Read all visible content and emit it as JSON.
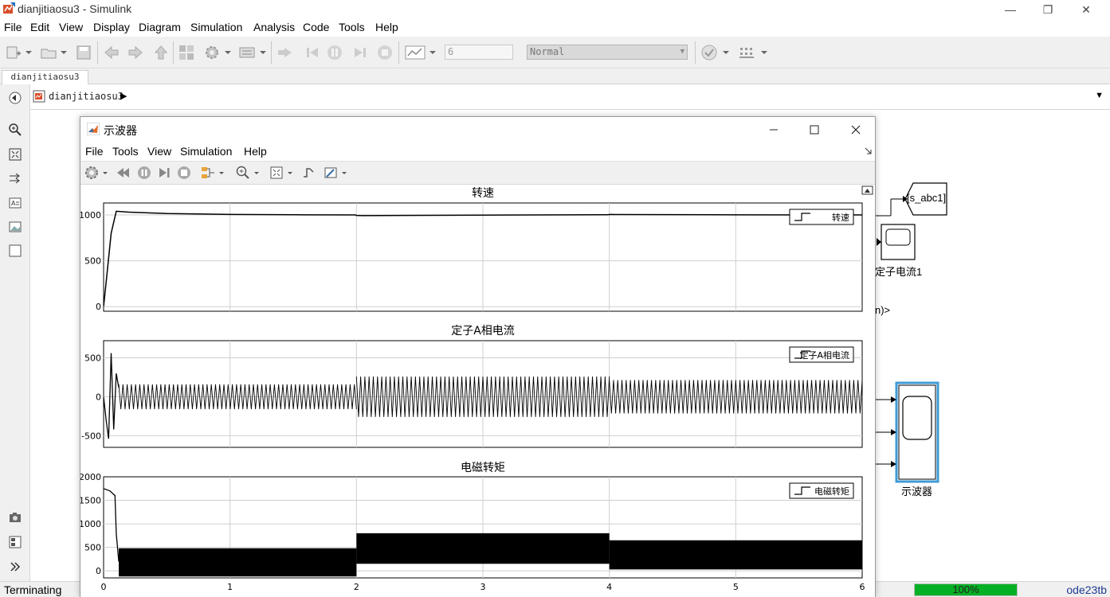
{
  "window": {
    "title": "dianjitiaosu3 - Simulink",
    "minimize": "—",
    "maximize": "❐",
    "close": "✕"
  },
  "menu": [
    "File",
    "Edit",
    "View",
    "Display",
    "Diagram",
    "Simulation",
    "Analysis",
    "Code",
    "Tools",
    "Help"
  ],
  "toolbar": {
    "stop_time": "6",
    "sim_mode": "Normal"
  },
  "tab": {
    "label": "dianjitiaosu3"
  },
  "address": {
    "model": "dianjitiaosu3"
  },
  "canvas": {
    "goto_tag": "[s_abc1]",
    "scope1_label": "定子电流1",
    "bus_fragment": "n)>",
    "scope2_label": "示波器"
  },
  "status": {
    "left": "Terminating",
    "progress_text": "100%",
    "progress": 1.0,
    "solver": "ode23tb"
  },
  "scope_window": {
    "title": "示波器",
    "menu": [
      "File",
      "Tools",
      "View",
      "Simulation",
      "Help"
    ]
  },
  "colors": {
    "progress": "#06b025",
    "selected_block": "#3f9bd6",
    "trace": "#000000"
  },
  "chart_data": [
    {
      "type": "line",
      "title": "转速",
      "legend": "转速",
      "legend_position": "top-right",
      "xlim": [
        0,
        6
      ],
      "ylim": [
        -50,
        1130
      ],
      "yticks": [
        0,
        500,
        1000
      ],
      "grid": true,
      "series": [
        {
          "name": "转速",
          "x": [
            0,
            0.03,
            0.06,
            0.1,
            0.2,
            0.5,
            1.0,
            1.5,
            1.99,
            2.0,
            2.05,
            3.0,
            3.99,
            4.0,
            4.05,
            5.0,
            6.0
          ],
          "y": [
            0,
            400,
            800,
            1040,
            1030,
            1015,
            1005,
            1002,
            1000,
            995,
            992,
            998,
            1002,
            1005,
            1004,
            1001,
            1000
          ]
        }
      ]
    },
    {
      "type": "line",
      "title": "定子A相电流",
      "legend": "定子A相电流",
      "legend_position": "top-right",
      "xlim": [
        0,
        6
      ],
      "ylim": [
        -650,
        720
      ],
      "yticks": [
        -500,
        0,
        500
      ],
      "grid": true,
      "series": [
        {
          "name": "定子A相电流",
          "startup": {
            "x": [
              0,
              0.02,
              0.04,
              0.06,
              0.08,
              0.1,
              0.12
            ],
            "y": [
              0,
              -300,
              -540,
              560,
              -420,
              300,
              120
            ]
          },
          "oscillation_envelope": [
            {
              "from": 0.12,
              "to": 2.0,
              "amplitude": 160
            },
            {
              "from": 2.0,
              "to": 4.0,
              "amplitude": 260
            },
            {
              "from": 4.0,
              "to": 6.0,
              "amplitude": 215
            }
          ]
        }
      ]
    },
    {
      "type": "line",
      "title": "电磁转矩",
      "legend": "电磁转矩",
      "legend_position": "top-right",
      "xlim": [
        0,
        6
      ],
      "ylim": [
        -150,
        2000
      ],
      "yticks": [
        0,
        500,
        1000,
        1500,
        2000
      ],
      "xticks": [
        0,
        1,
        2,
        3,
        4,
        5,
        6
      ],
      "grid": true,
      "series": [
        {
          "name": "电磁转矩",
          "startup": {
            "x": [
              0,
              0.05,
              0.09,
              0.1,
              0.12
            ],
            "y": [
              1750,
              1700,
              1600,
              800,
              200
            ]
          },
          "band": [
            {
              "from": 0.12,
              "to": 2.0,
              "low": -120,
              "high": 480
            },
            {
              "from": 2.0,
              "to": 4.0,
              "low": 150,
              "high": 800
            },
            {
              "from": 4.0,
              "to": 6.0,
              "low": 30,
              "high": 650
            }
          ]
        }
      ]
    }
  ]
}
